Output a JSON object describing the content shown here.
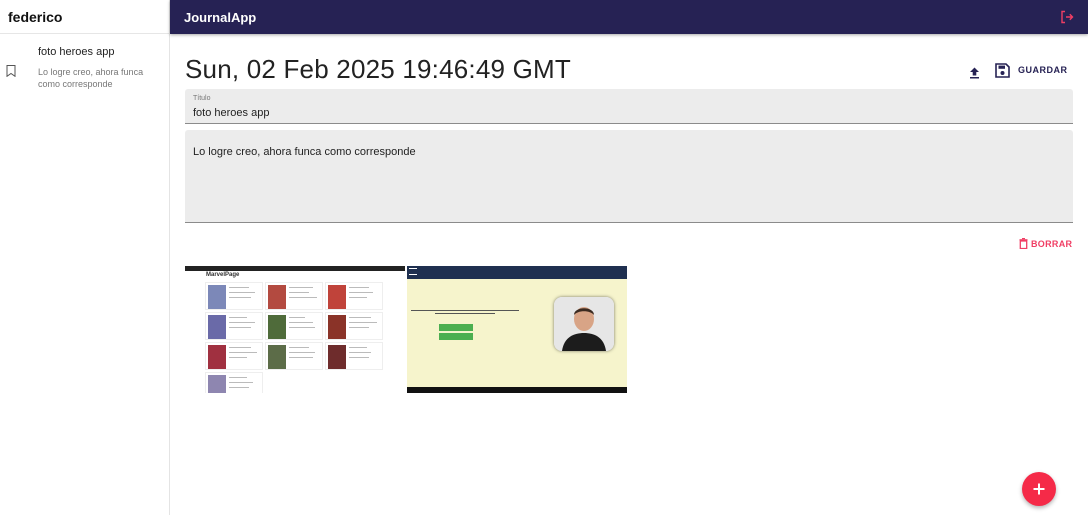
{
  "sidebar": {
    "username": "federico",
    "notes": [
      {
        "title": "foto heroes app",
        "body": "Lo logre creo, ahora funca como corresponde",
        "icon": "bookmark-icon"
      }
    ]
  },
  "topbar": {
    "app_title": "JournalApp",
    "logout_icon": "logout-icon"
  },
  "note": {
    "date": "Sun, 02 Feb 2025 19:46:49 GMT",
    "save_label": "GUARDAR",
    "title_label": "Título",
    "title_value": "foto heroes app",
    "body_value": "Lo logre creo, ahora funca como corresponde",
    "delete_label": "BORRAR",
    "images": [
      {
        "caption": "MarvelPage"
      },
      {
        "caption": ""
      }
    ]
  },
  "colors": {
    "primary": "#262254",
    "error": "#f03e64",
    "fab": "#f52a48"
  }
}
